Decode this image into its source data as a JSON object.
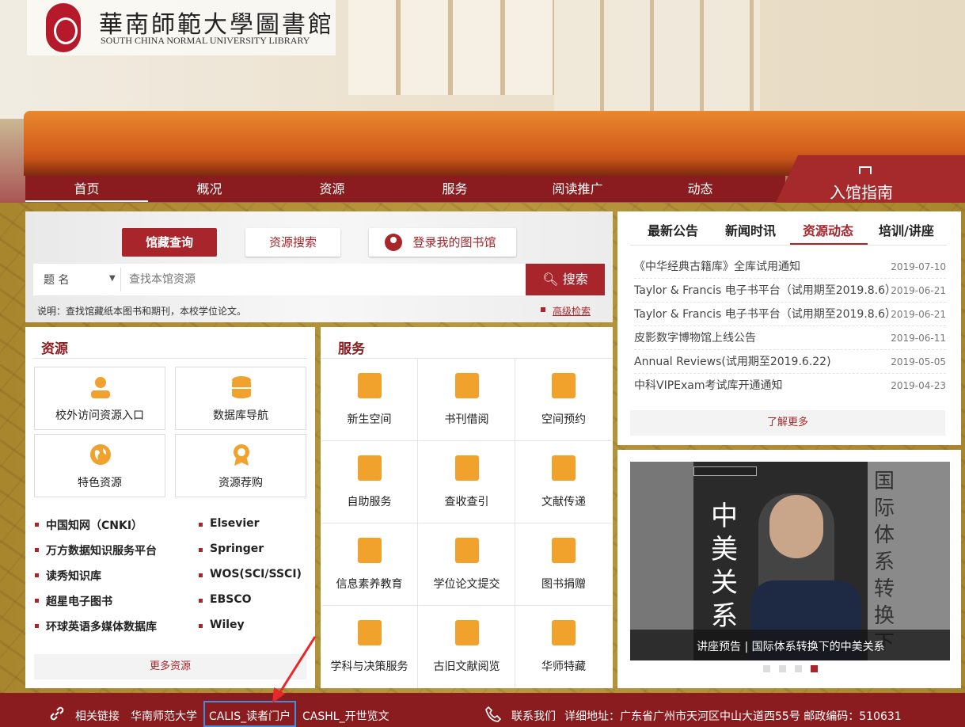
{
  "header": {
    "logo_cn": "華南師範大學圖書館",
    "logo_en": "SOUTH CHINA NORMAL UNIVERSITY LIBRARY"
  },
  "nav": {
    "items": [
      "首页",
      "概况",
      "资源",
      "服务",
      "阅读推广",
      "动态"
    ],
    "guide": "入馆指南"
  },
  "search": {
    "tabs": [
      "馆藏查询",
      "资源搜索",
      "登录我的图书馆"
    ],
    "select": "题 名",
    "placeholder": "查找本馆资源",
    "button": "搜索",
    "note": "说明：查找馆藏纸本图书和期刊，本校学位论文。",
    "advanced": "高级检索"
  },
  "resources": {
    "title": "资源",
    "cards": [
      "校外访问资源入口",
      "数据库导航",
      "特色资源",
      "资源荐购"
    ],
    "links_left": [
      "中国知网（CNKI）",
      "万方数据知识服务平台",
      "读秀知识库",
      "超星电子图书",
      "环球英语多媒体数据库"
    ],
    "links_right": [
      "Elsevier",
      "Springer",
      "WOS(SCI/SSCI)",
      "EBSCO",
      "Wiley"
    ],
    "more": "更多资源"
  },
  "services": {
    "title": "服务",
    "items": [
      "新生空间",
      "书刊借阅",
      "空间预约",
      "自助服务",
      "查收查引",
      "文献传递",
      "信息素养教育",
      "学位论文提交",
      "图书捐赠",
      "学科与决策服务",
      "古旧文献阅览",
      "华师特藏"
    ]
  },
  "news": {
    "tabs": [
      "最新公告",
      "新闻时讯",
      "资源动态",
      "培训/讲座"
    ],
    "rows": [
      {
        "title": "《中华经典古籍库》全库试用通知",
        "date": "2019-07-10"
      },
      {
        "title": "Taylor & Francis 电子书平台（试用期至2019.8.6）",
        "date": "2019-06-21"
      },
      {
        "title": "Taylor & Francis 电子书平台（试用期至2019.8.6）",
        "date": "2019-06-21"
      },
      {
        "title": "皮影数字博物馆上线公告",
        "date": "2019-06-11"
      },
      {
        "title": "Annual Reviews(试用期至2019.6.22)",
        "date": "2019-05-05"
      },
      {
        "title": "中科VIPExam考试库开通通知",
        "date": "2019-04-23"
      }
    ],
    "more": "了解更多"
  },
  "slide": {
    "caption": "讲座预告 | 国际体系转换下的中美关系",
    "cover_top": "中美关系",
    "cover_side": "国际体系转换下"
  },
  "footer": {
    "links_label": "相关链接",
    "links": [
      "华南师范大学",
      "CALIS_读者门户",
      "CASHL_开世览文"
    ],
    "contact_label": "联系我们",
    "address": "详细地址：广东省广州市天河区中山大道西55号 邮政编码：510631"
  },
  "colors": {
    "brand": "#8a1c1f",
    "accent": "#a8262b",
    "icon": "#f0a22c"
  }
}
